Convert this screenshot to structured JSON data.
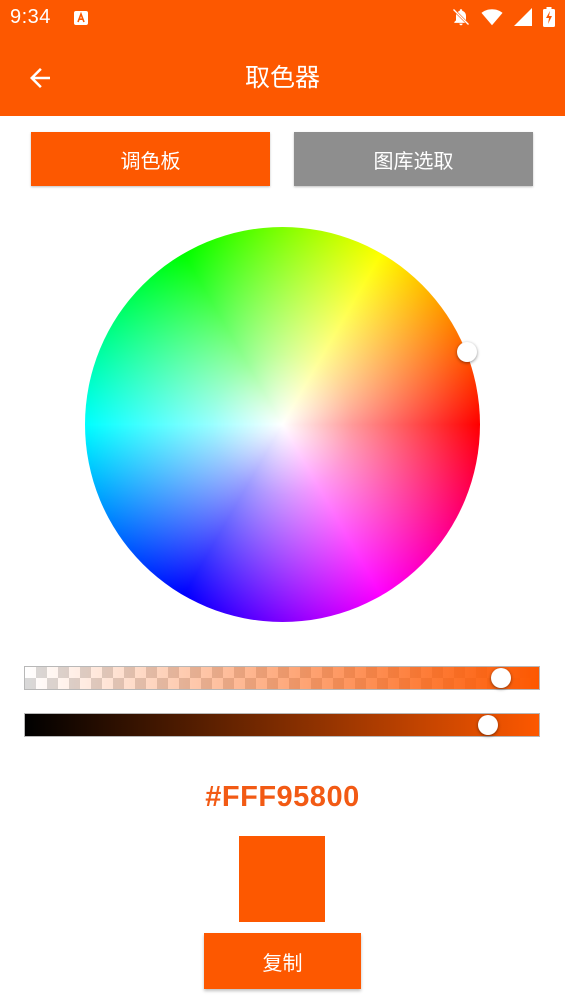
{
  "status_bar": {
    "time": "9:34",
    "icons": [
      "app-notification-icon",
      "bell-off-icon",
      "wifi-icon",
      "signal-icon",
      "battery-charging-icon"
    ]
  },
  "app_bar": {
    "title": "取色器",
    "back_icon": "arrow-left-icon"
  },
  "tabs": [
    {
      "label": "调色板",
      "active": true
    },
    {
      "label": "图库选取",
      "active": false
    }
  ],
  "picker": {
    "alpha_level": 0.95,
    "value_level": 0.93
  },
  "result": {
    "hex": "#FFF95800",
    "copy_label": "复制"
  },
  "colors": {
    "accent": "#FD5800",
    "tab_inactive": "#8E8E8E",
    "hex_text": "#F25A14",
    "selected_color": "#FD5800"
  }
}
